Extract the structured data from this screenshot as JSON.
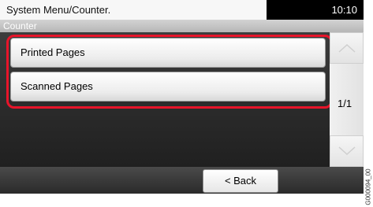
{
  "header": {
    "title": "System Menu/Counter.",
    "time": "10:10"
  },
  "subheader": {
    "title": "Counter"
  },
  "list": {
    "items": [
      {
        "label": "Printed Pages"
      },
      {
        "label": "Scanned Pages"
      }
    ]
  },
  "scroll": {
    "page_indicator": "1/1",
    "up_icon": "chevron-up-icon",
    "down_icon": "chevron-down-icon"
  },
  "footer": {
    "back_label": "< Back"
  },
  "side_code": "G000094_00",
  "colors": {
    "highlight": "#e8142a",
    "titlebar": "#000000"
  }
}
